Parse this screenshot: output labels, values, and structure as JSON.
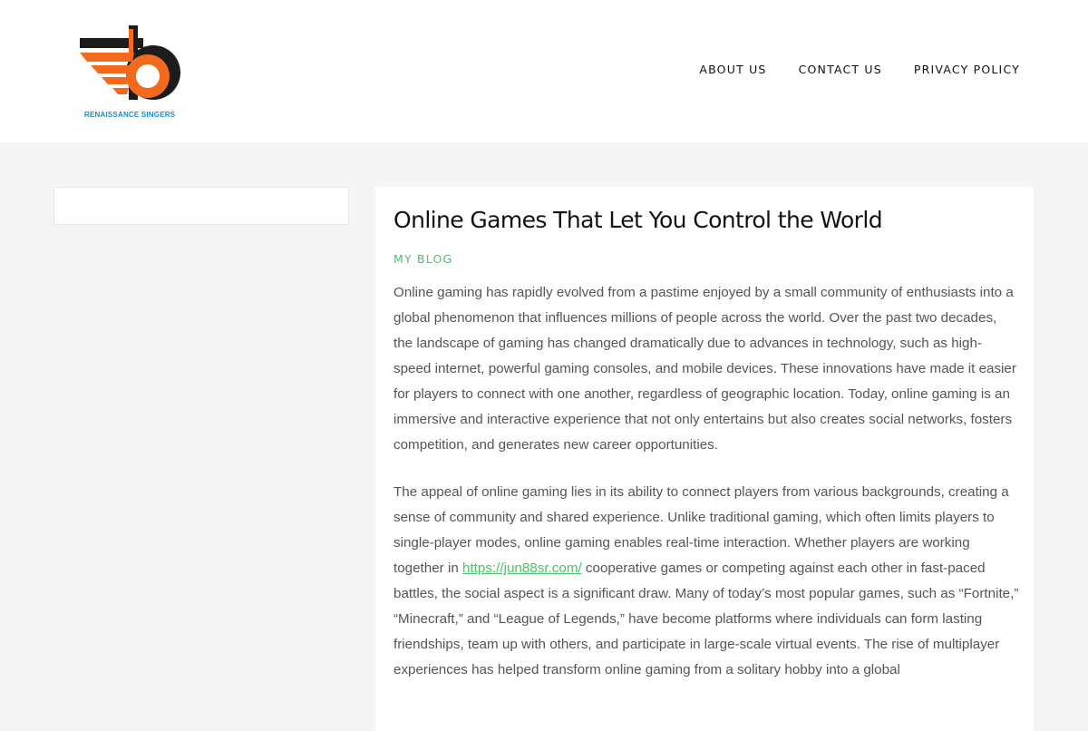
{
  "header": {
    "logo_text": "RENAISSANCE SINGERS",
    "brand_colors": {
      "orange": "#f26b1d",
      "dark": "#1c1c1c",
      "text_blue": "#1a8fc4"
    },
    "nav": [
      {
        "label": "ABOUT US"
      },
      {
        "label": "CONTACT US"
      },
      {
        "label": "PRIVACY POLICY"
      }
    ]
  },
  "post": {
    "title": "Online Games That Let You Control the World",
    "category": "MY BLOG",
    "paragraph1": "Online gaming has rapidly evolved from a pastime enjoyed by a small community of enthusiasts into a global phenomenon that influences millions of people across the world. Over the past two decades, the landscape of gaming has changed dramatically due to advances in technology, such as high-speed internet, powerful gaming consoles, and mobile devices. These innovations have made it easier for players to connect with one another, regardless of geographic location. Today, online gaming is an immersive and interactive experience that not only entertains but also creates social networks, fosters competition, and generates new career opportunities.",
    "paragraph2_before_link": "The appeal of online gaming lies in its ability to connect players from various backgrounds, creating a sense of community and shared experience. Unlike traditional gaming, which often limits players to single-player modes, online gaming enables real-time interaction. Whether players are working together in ",
    "paragraph2_link": "https://jun88sr.com/",
    "paragraph2_after_link": " cooperative games or competing against each other in fast-paced battles, the social aspect is a significant draw. Many of today’s most popular games, such as “Fortnite,” “Minecraft,” and “League of Legends,” have become platforms where individuals can form lasting friendships, team up with others, and participate in large-scale virtual events. The rise of multiplayer experiences has helped transform online gaming from a solitary hobby into a global"
  },
  "colors": {
    "page_background": "#f5f5f5",
    "accent_green": "#4cc26a"
  }
}
